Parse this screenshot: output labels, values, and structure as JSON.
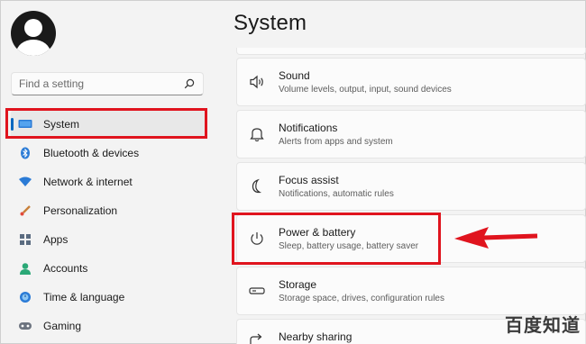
{
  "sidebar": {
    "search": {
      "placeholder": "Find a setting",
      "value": ""
    },
    "items": [
      {
        "label": "System",
        "icon": "monitor-icon",
        "active": true
      },
      {
        "label": "Bluetooth & devices",
        "icon": "bluetooth-icon"
      },
      {
        "label": "Network & internet",
        "icon": "wifi-icon"
      },
      {
        "label": "Personalization",
        "icon": "brush-icon"
      },
      {
        "label": "Apps",
        "icon": "apps-icon"
      },
      {
        "label": "Accounts",
        "icon": "accounts-icon"
      },
      {
        "label": "Time & language",
        "icon": "globe-clock-icon"
      },
      {
        "label": "Gaming",
        "icon": "gamepad-icon"
      }
    ]
  },
  "main": {
    "title": "System",
    "cards": [
      {
        "title": "Sound",
        "subtitle": "Volume levels, output, input, sound devices",
        "icon": "speaker-icon"
      },
      {
        "title": "Notifications",
        "subtitle": "Alerts from apps and system",
        "icon": "bell-icon"
      },
      {
        "title": "Focus assist",
        "subtitle": "Notifications, automatic rules",
        "icon": "moon-icon"
      },
      {
        "title": "Power & battery",
        "subtitle": "Sleep, battery usage, battery saver",
        "icon": "power-icon"
      },
      {
        "title": "Storage",
        "subtitle": "Storage space, drives, configuration rules",
        "icon": "drive-icon"
      },
      {
        "title": "Nearby sharing",
        "subtitle": "",
        "icon": "share-icon"
      }
    ]
  },
  "watermark": "百度知道",
  "colors": {
    "accent": "#0067c0",
    "highlight": "#e0141e"
  }
}
